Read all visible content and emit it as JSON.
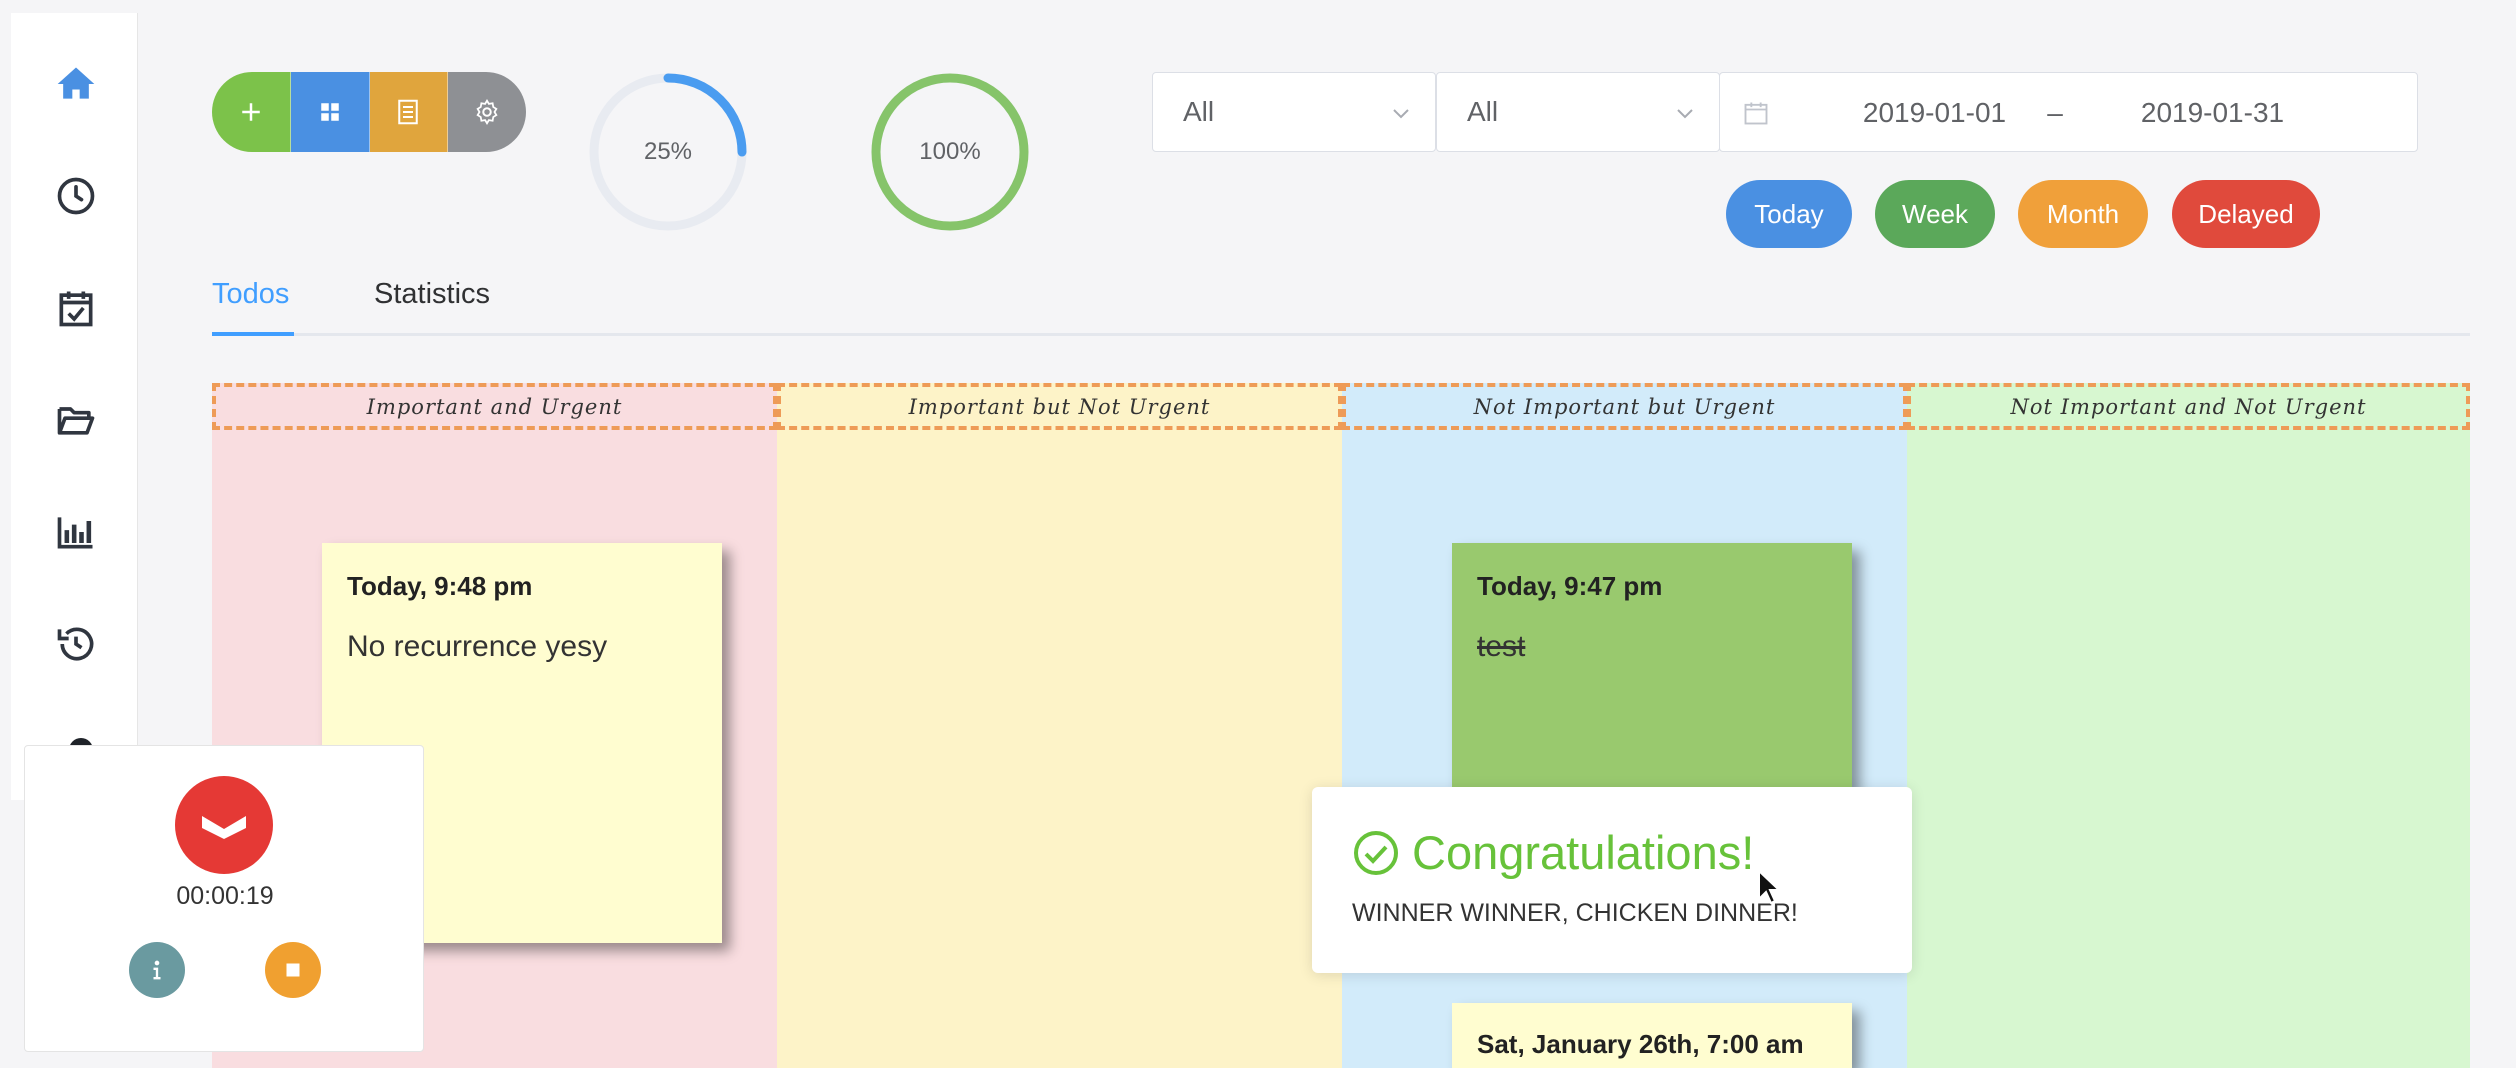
{
  "colors": {
    "primary": "#409eff",
    "success": "#67c23a",
    "warning": "#f0a03a",
    "danger": "#e74c3c",
    "sidebar_active": "#4a90e2",
    "icon_dark": "#303640"
  },
  "sidebar": {
    "items": [
      {
        "icon": "home-icon"
      },
      {
        "icon": "clock-icon"
      },
      {
        "icon": "calendar-check-icon"
      },
      {
        "icon": "folder-open-icon"
      },
      {
        "icon": "bar-chart-icon"
      },
      {
        "icon": "history-icon"
      }
    ]
  },
  "actions": [
    {
      "icon": "plus-icon",
      "color": "#7cc24a"
    },
    {
      "icon": "grid-icon",
      "color": "#4a90e2"
    },
    {
      "icon": "list-icon",
      "color": "#e0a53d"
    },
    {
      "icon": "gear-icon",
      "color": "#8e9094"
    }
  ],
  "progress": [
    {
      "label": "25%",
      "value": 0.25,
      "color": "#4a9cf0"
    },
    {
      "label": "100%",
      "value": 1.0,
      "color": "#86c46a"
    }
  ],
  "filters": {
    "select1": "All",
    "select2": "All",
    "date_start": "2019-01-01",
    "date_sep": "–",
    "date_end": "2019-01-31",
    "buttons": [
      {
        "label": "Today",
        "color": "#4a90e2"
      },
      {
        "label": "Week",
        "color": "#5ba85a"
      },
      {
        "label": "Month",
        "color": "#f0a03a"
      },
      {
        "label": "Delayed",
        "color": "#e04a3c"
      }
    ]
  },
  "tabs": [
    {
      "label": "Todos",
      "active": true
    },
    {
      "label": "Statistics",
      "active": false
    }
  ],
  "quadrants": [
    {
      "title": "Important and Urgent",
      "bg": "#f9dde0",
      "header_bg": "#f9dde0"
    },
    {
      "title": "Important but Not Urgent",
      "bg": "#fdf3c8",
      "header_bg": "#fdf3c8"
    },
    {
      "title": "Not Important but Urgent",
      "bg": "#d2ebfa",
      "header_bg": "#d2ebfa"
    },
    {
      "title": "Not Important and Not Urgent",
      "bg": "#d7f7d0",
      "header_bg": "#d7f7d0"
    }
  ],
  "notes": [
    {
      "time": "Today, 9:48 pm",
      "text": "No recurrence yesy",
      "color": "#fffdd0",
      "done": false
    },
    {
      "time": "Today, 9:47 pm",
      "text": "test",
      "color": "#99c96e",
      "done": true
    },
    {
      "time": "Sat, January 26th, 7:00 am",
      "text": "",
      "color": "#fffdd0",
      "done": false
    }
  ],
  "notification": {
    "title": "Congratulations!",
    "message": "WINNER WINNER, CHICKEN DINNER!"
  },
  "timer": {
    "time": "00:00:19",
    "info_color": "#6a9aa0",
    "stop_color": "#f0a030"
  }
}
